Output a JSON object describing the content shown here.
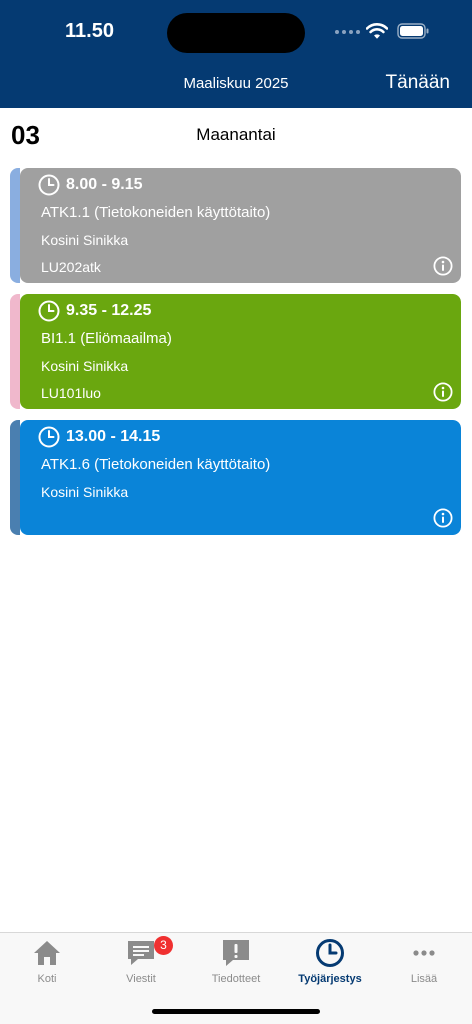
{
  "status_bar": {
    "time": "11.50"
  },
  "header": {
    "title": "Maaliskuu 2025",
    "today_label": "Tänään"
  },
  "day": {
    "number": "03",
    "name": "Maanantai"
  },
  "lessons": [
    {
      "time": "8.00 - 9.15",
      "course": "ATK1.1 (Tietokoneiden käyttötaito)",
      "teacher": "Kosini Sinikka",
      "room": "LU202atk",
      "color": "#a0a0a0",
      "stripe_color": "#8aaee0"
    },
    {
      "time": "9.35 - 12.25",
      "course": "BI1.1 (Eliömaailma)",
      "teacher": "Kosini Sinikka",
      "room": "LU101luo",
      "color": "#6aa70f",
      "stripe_color": "#f0b8cc"
    },
    {
      "time": "13.00 - 14.15",
      "course": "ATK1.6 (Tietokoneiden käyttötaito)",
      "teacher": "Kosini Sinikka",
      "room": "",
      "color": "#0a84d8",
      "stripe_color": "#4a7fb0"
    }
  ],
  "tabbar": {
    "tabs": [
      {
        "label": "Koti",
        "icon": "home-icon"
      },
      {
        "label": "Viestit",
        "icon": "messages-icon",
        "badge": "3"
      },
      {
        "label": "Tiedotteet",
        "icon": "announcements-icon"
      },
      {
        "label": "Työjärjestys",
        "icon": "clock-icon",
        "active": true
      },
      {
        "label": "Lisää",
        "icon": "more-icon"
      }
    ]
  },
  "colors": {
    "header_bg": "#053a72",
    "active_tab": "#053a72",
    "badge": "#f03030"
  }
}
